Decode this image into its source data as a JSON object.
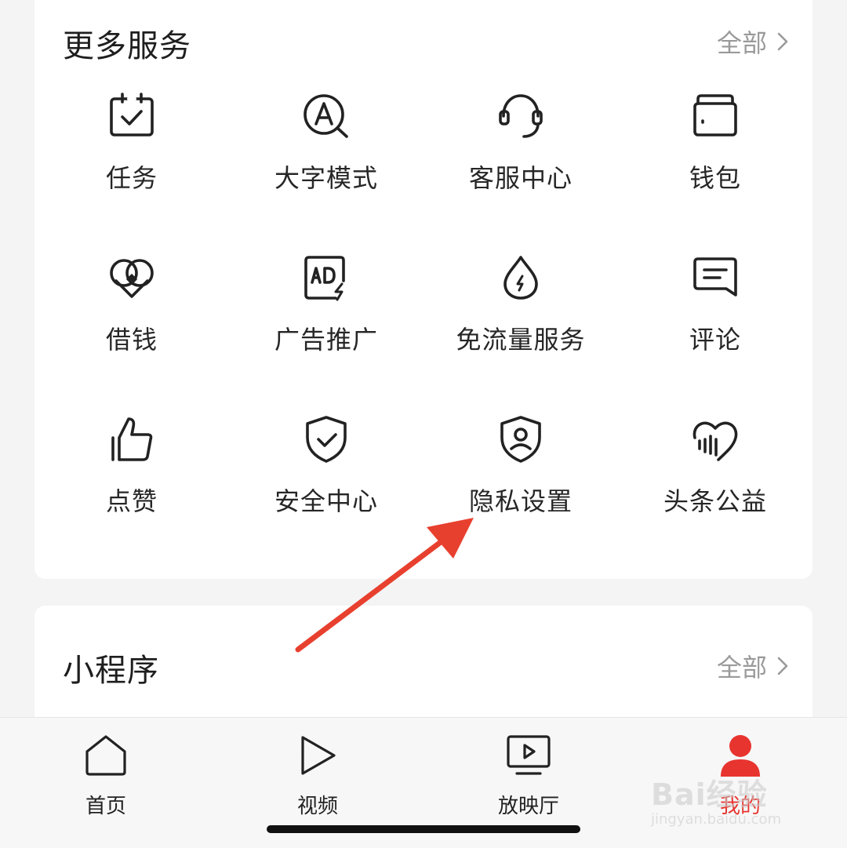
{
  "services_card": {
    "title": "更多服务",
    "more_label": "全部",
    "items": [
      {
        "label": "任务",
        "icon": "task-calendar-icon"
      },
      {
        "label": "大字模式",
        "icon": "large-font-icon"
      },
      {
        "label": "客服中心",
        "icon": "headset-icon"
      },
      {
        "label": "钱包",
        "icon": "wallet-icon"
      },
      {
        "label": "借钱",
        "icon": "loan-icon"
      },
      {
        "label": "广告推广",
        "icon": "ad-icon"
      },
      {
        "label": "免流量服务",
        "icon": "data-drop-icon"
      },
      {
        "label": "评论",
        "icon": "comment-icon"
      },
      {
        "label": "点赞",
        "icon": "thumbs-up-icon"
      },
      {
        "label": "安全中心",
        "icon": "shield-check-icon"
      },
      {
        "label": "隐私设置",
        "icon": "privacy-shield-icon"
      },
      {
        "label": "头条公益",
        "icon": "charity-heart-icon"
      }
    ]
  },
  "mini_programs_card": {
    "title": "小程序",
    "more_label": "全部"
  },
  "tabbar": {
    "items": [
      {
        "label": "首页",
        "icon": "home-icon"
      },
      {
        "label": "视频",
        "icon": "play-icon"
      },
      {
        "label": "放映厅",
        "icon": "tv-icon"
      },
      {
        "label": "我的",
        "icon": "profile-icon",
        "active": true
      }
    ]
  },
  "watermark": {
    "brand": "Bai经验",
    "url": "jingyan.baidu.com"
  },
  "colors": {
    "accent_red": "#e8342f",
    "annotation_arrow": "#e8402f"
  }
}
